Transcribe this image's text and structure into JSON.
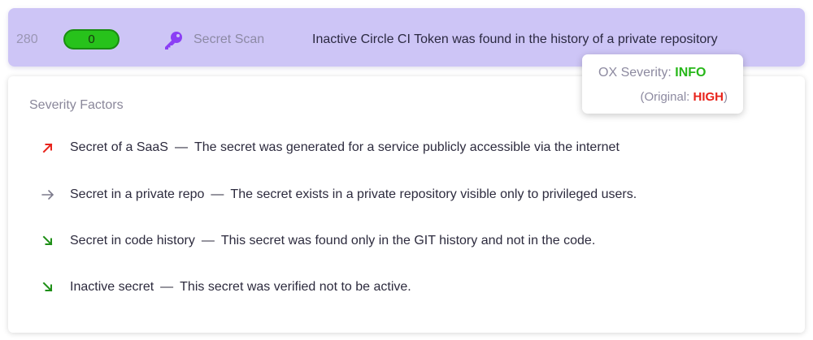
{
  "issue": {
    "id": "280",
    "score": "0",
    "category": "Secret Scan",
    "category_icon": "key-icon",
    "title": "Inactive Circle CI Token was found in the history of a private repository"
  },
  "severity_popup": {
    "label": "OX Severity:",
    "value": "INFO",
    "value_color": "#27b719",
    "original_open": "(Original:",
    "original_value": "HIGH",
    "original_close": ")",
    "original_color": "#e8231b"
  },
  "severity_factors": {
    "heading": "Severity Factors",
    "separator": "—",
    "items": [
      {
        "icon": "arrow-up-right-icon",
        "color": "#e8231b",
        "name": "Secret of a SaaS",
        "description": "The secret was generated for a service publicly accessible via the internet"
      },
      {
        "icon": "arrow-right-icon",
        "color": "#7c7a8c",
        "name": "Secret in a private repo",
        "description": "The secret exists in a private repository visible only to privileged users."
      },
      {
        "icon": "arrow-down-right-icon",
        "color": "#1f8f17",
        "name": "Secret in code history",
        "description": "This secret was found only in the GIT history and not in the code."
      },
      {
        "icon": "arrow-down-right-icon",
        "color": "#1f8f17",
        "name": "Inactive secret",
        "description": "This secret was verified not to be active."
      }
    ]
  },
  "colors": {
    "row_background": "#cdc5f6",
    "score_pill": "#27c21b",
    "key_icon": "#8b3ff5"
  }
}
